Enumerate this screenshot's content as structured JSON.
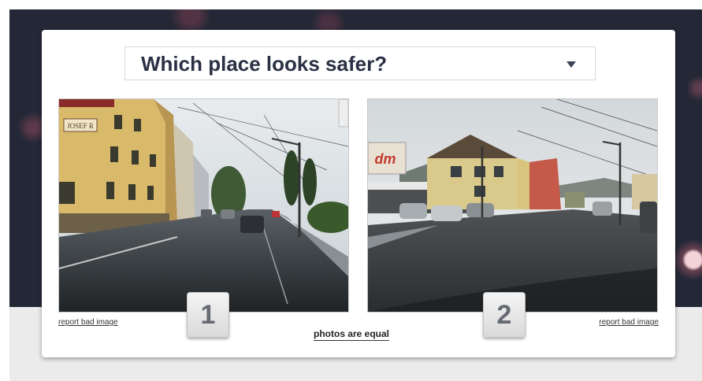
{
  "question": {
    "text": "Which place looks safer?",
    "dropdown_icon": "chevron-down-icon"
  },
  "photos": [
    {
      "id": "1",
      "label": "1",
      "report_label": "report bad image",
      "sign_text": "JOSEF R"
    },
    {
      "id": "2",
      "label": "2",
      "report_label": "report bad image",
      "sign_text": "dm"
    }
  ],
  "equal_label": "photos are equal",
  "colors": {
    "background_dark": "#242836",
    "background_light": "#ebebeb",
    "question_text": "#2a3144",
    "button_text": "#666a72"
  }
}
